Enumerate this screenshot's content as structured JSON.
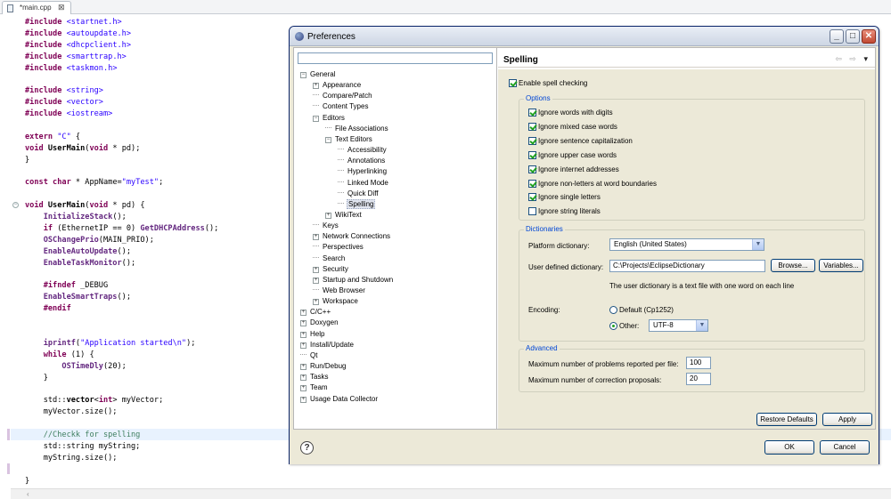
{
  "editor": {
    "tab_label": "*main.cpp",
    "tab_close_glyph": "⊠",
    "lines": [
      [
        {
          "t": "#include ",
          "c": "inc"
        },
        {
          "t": "<startnet.h>",
          "c": "str"
        }
      ],
      [
        {
          "t": "#include ",
          "c": "inc"
        },
        {
          "t": "<autoupdate.h>",
          "c": "str"
        }
      ],
      [
        {
          "t": "#include ",
          "c": "inc"
        },
        {
          "t": "<dhcpclient.h>",
          "c": "str"
        }
      ],
      [
        {
          "t": "#include ",
          "c": "inc"
        },
        {
          "t": "<smarttrap.h>",
          "c": "str"
        }
      ],
      [
        {
          "t": "#include ",
          "c": "inc"
        },
        {
          "t": "<taskmon.h>",
          "c": "str"
        }
      ],
      [],
      [
        {
          "t": "#include ",
          "c": "inc"
        },
        {
          "t": "<string>",
          "c": "str"
        }
      ],
      [
        {
          "t": "#include ",
          "c": "inc"
        },
        {
          "t": "<vector>",
          "c": "str"
        }
      ],
      [
        {
          "t": "#include ",
          "c": "inc"
        },
        {
          "t": "<iostream>",
          "c": "str"
        }
      ],
      [],
      [
        {
          "t": "extern ",
          "c": "kw"
        },
        {
          "t": "\"C\"",
          "c": "str"
        },
        {
          "t": " {",
          "c": ""
        }
      ],
      [
        {
          "t": "void ",
          "c": "kw"
        },
        {
          "t": "UserMain",
          "c": "ty"
        },
        {
          "t": "(",
          "c": ""
        },
        {
          "t": "void",
          "c": "kw"
        },
        {
          "t": " * pd);",
          "c": ""
        }
      ],
      [
        {
          "t": "}",
          "c": ""
        }
      ],
      [],
      [
        {
          "t": "const ",
          "c": "kw"
        },
        {
          "t": "char",
          "c": "kw"
        },
        {
          "t": " * AppName=",
          "c": ""
        },
        {
          "t": "\"myTest\"",
          "c": "str"
        },
        {
          "t": ";",
          "c": ""
        }
      ],
      [],
      [
        {
          "t": "void ",
          "c": "kw"
        },
        {
          "t": "UserMain",
          "c": "ty"
        },
        {
          "t": "(",
          "c": ""
        },
        {
          "t": "void",
          "c": "kw"
        },
        {
          "t": " * pd) {",
          "c": ""
        }
      ],
      [
        {
          "t": "    ",
          "c": ""
        },
        {
          "t": "InitializeStack",
          "c": "fn"
        },
        {
          "t": "();",
          "c": ""
        }
      ],
      [
        {
          "t": "    ",
          "c": ""
        },
        {
          "t": "if",
          "c": "kw"
        },
        {
          "t": " (EthernetIP == 0) ",
          "c": ""
        },
        {
          "t": "GetDHCPAddress",
          "c": "fn"
        },
        {
          "t": "();",
          "c": ""
        }
      ],
      [
        {
          "t": "    ",
          "c": ""
        },
        {
          "t": "OSChangePrio",
          "c": "fn"
        },
        {
          "t": "(MAIN_PRIO);",
          "c": ""
        }
      ],
      [
        {
          "t": "    ",
          "c": ""
        },
        {
          "t": "EnableAutoUpdate",
          "c": "fn"
        },
        {
          "t": "();",
          "c": ""
        }
      ],
      [
        {
          "t": "    ",
          "c": ""
        },
        {
          "t": "EnableTaskMonitor",
          "c": "fn"
        },
        {
          "t": "();",
          "c": ""
        }
      ],
      [],
      [
        {
          "t": "    ",
          "c": ""
        },
        {
          "t": "#ifndef",
          "c": "inc"
        },
        {
          "t": " _DEBUG",
          "c": ""
        }
      ],
      [
        {
          "t": "    ",
          "c": ""
        },
        {
          "t": "EnableSmartTraps",
          "c": "fn"
        },
        {
          "t": "();",
          "c": ""
        }
      ],
      [
        {
          "t": "    ",
          "c": ""
        },
        {
          "t": "#endif",
          "c": "inc"
        }
      ],
      [],
      [],
      [
        {
          "t": "    ",
          "c": ""
        },
        {
          "t": "iprintf",
          "c": "fn"
        },
        {
          "t": "(",
          "c": ""
        },
        {
          "t": "\"Application started\\n\"",
          "c": "str"
        },
        {
          "t": ");",
          "c": ""
        }
      ],
      [
        {
          "t": "    ",
          "c": ""
        },
        {
          "t": "while",
          "c": "kw"
        },
        {
          "t": " (1) {",
          "c": ""
        }
      ],
      [
        {
          "t": "        ",
          "c": ""
        },
        {
          "t": "OSTimeDly",
          "c": "fn"
        },
        {
          "t": "(20);",
          "c": ""
        }
      ],
      [
        {
          "t": "    }",
          "c": ""
        }
      ],
      [],
      [
        {
          "t": "    std::",
          "c": ""
        },
        {
          "t": "vector",
          "c": "ty"
        },
        {
          "t": "<",
          "c": ""
        },
        {
          "t": "int",
          "c": "kw"
        },
        {
          "t": "> myVector;",
          "c": ""
        }
      ],
      [
        {
          "t": "    myVector.size();",
          "c": ""
        }
      ],
      [],
      [
        {
          "t": "    ",
          "c": ""
        },
        {
          "t": "//Checkk for spelling",
          "c": "cm"
        }
      ],
      [
        {
          "t": "    std::string myString;",
          "c": ""
        }
      ],
      [
        {
          "t": "    myString.size();",
          "c": ""
        }
      ],
      [],
      [
        {
          "t": "}",
          "c": ""
        }
      ]
    ]
  },
  "dialog": {
    "title": "Preferences",
    "buttons": {
      "minimize": "_",
      "maximize": "□",
      "close": "✕"
    },
    "filter_value": "",
    "tree": [
      {
        "label": "General",
        "level": 0,
        "exp": "−"
      },
      {
        "label": "Appearance",
        "level": 1,
        "exp": "+"
      },
      {
        "label": "Compare/Patch",
        "level": 1,
        "exp": ""
      },
      {
        "label": "Content Types",
        "level": 1,
        "exp": ""
      },
      {
        "label": "Editors",
        "level": 1,
        "exp": "−"
      },
      {
        "label": "File Associations",
        "level": 2,
        "exp": ""
      },
      {
        "label": "Text Editors",
        "level": 2,
        "exp": "−"
      },
      {
        "label": "Accessibility",
        "level": 3,
        "exp": ""
      },
      {
        "label": "Annotations",
        "level": 3,
        "exp": ""
      },
      {
        "label": "Hyperlinking",
        "level": 3,
        "exp": ""
      },
      {
        "label": "Linked Mode",
        "level": 3,
        "exp": ""
      },
      {
        "label": "Quick Diff",
        "level": 3,
        "exp": ""
      },
      {
        "label": "Spelling",
        "level": 3,
        "exp": "",
        "selected": true
      },
      {
        "label": "WikiText",
        "level": 2,
        "exp": "+"
      },
      {
        "label": "Keys",
        "level": 1,
        "exp": ""
      },
      {
        "label": "Network Connections",
        "level": 1,
        "exp": "+"
      },
      {
        "label": "Perspectives",
        "level": 1,
        "exp": ""
      },
      {
        "label": "Search",
        "level": 1,
        "exp": ""
      },
      {
        "label": "Security",
        "level": 1,
        "exp": "+"
      },
      {
        "label": "Startup and Shutdown",
        "level": 1,
        "exp": "+"
      },
      {
        "label": "Web Browser",
        "level": 1,
        "exp": ""
      },
      {
        "label": "Workspace",
        "level": 1,
        "exp": "+"
      },
      {
        "label": "C/C++",
        "level": 0,
        "exp": "+"
      },
      {
        "label": "Doxygen",
        "level": 0,
        "exp": "+"
      },
      {
        "label": "Help",
        "level": 0,
        "exp": "+"
      },
      {
        "label": "Install/Update",
        "level": 0,
        "exp": "+"
      },
      {
        "label": "Qt",
        "level": 0,
        "exp": ""
      },
      {
        "label": "Run/Debug",
        "level": 0,
        "exp": "+"
      },
      {
        "label": "Tasks",
        "level": 0,
        "exp": "+"
      },
      {
        "label": "Team",
        "level": 0,
        "exp": "+"
      },
      {
        "label": "Usage Data Collector",
        "level": 0,
        "exp": "+"
      }
    ],
    "page": {
      "title": "Spelling",
      "nav": {
        "back": "⇦",
        "forward": "⇨",
        "menu": "▾"
      },
      "enable": {
        "label": "Enable spell checking",
        "checked": true
      },
      "options": {
        "title": "Options",
        "items": [
          {
            "label": "Ignore words with digits",
            "checked": true
          },
          {
            "label": "Ignore mixed case words",
            "checked": true
          },
          {
            "label": "Ignore sentence capitalization",
            "checked": true
          },
          {
            "label": "Ignore upper case words",
            "checked": true
          },
          {
            "label": "Ignore internet addresses",
            "checked": true
          },
          {
            "label": "Ignore non-letters at word boundaries",
            "checked": true
          },
          {
            "label": "Ignore single letters",
            "checked": true
          },
          {
            "label": "Ignore string literals",
            "checked": false
          }
        ]
      },
      "dictionaries": {
        "title": "Dictionaries",
        "platform_label": "Platform dictionary:",
        "platform_value": "English (United States)",
        "user_label": "User defined dictionary:",
        "user_value": "C:\\Projects\\EclipseDictionary",
        "browse_label": "Browse...",
        "variables_label": "Variables...",
        "note": "The user dictionary is a text file with one word on each line",
        "encoding_label": "Encoding:",
        "default_label": "Default (Cp1252)",
        "other_label": "Other:",
        "other_value": "UTF-8",
        "selected_encoding": "other"
      },
      "advanced": {
        "title": "Advanced",
        "max_problems_label": "Maximum number of problems reported per file:",
        "max_problems_value": "100",
        "max_proposals_label": "Maximum number of correction proposals:",
        "max_proposals_value": "20"
      },
      "restore_defaults_label": "Restore Defaults",
      "apply_label": "Apply"
    },
    "footer": {
      "help_glyph": "?",
      "ok_label": "OK",
      "cancel_label": "Cancel"
    }
  }
}
